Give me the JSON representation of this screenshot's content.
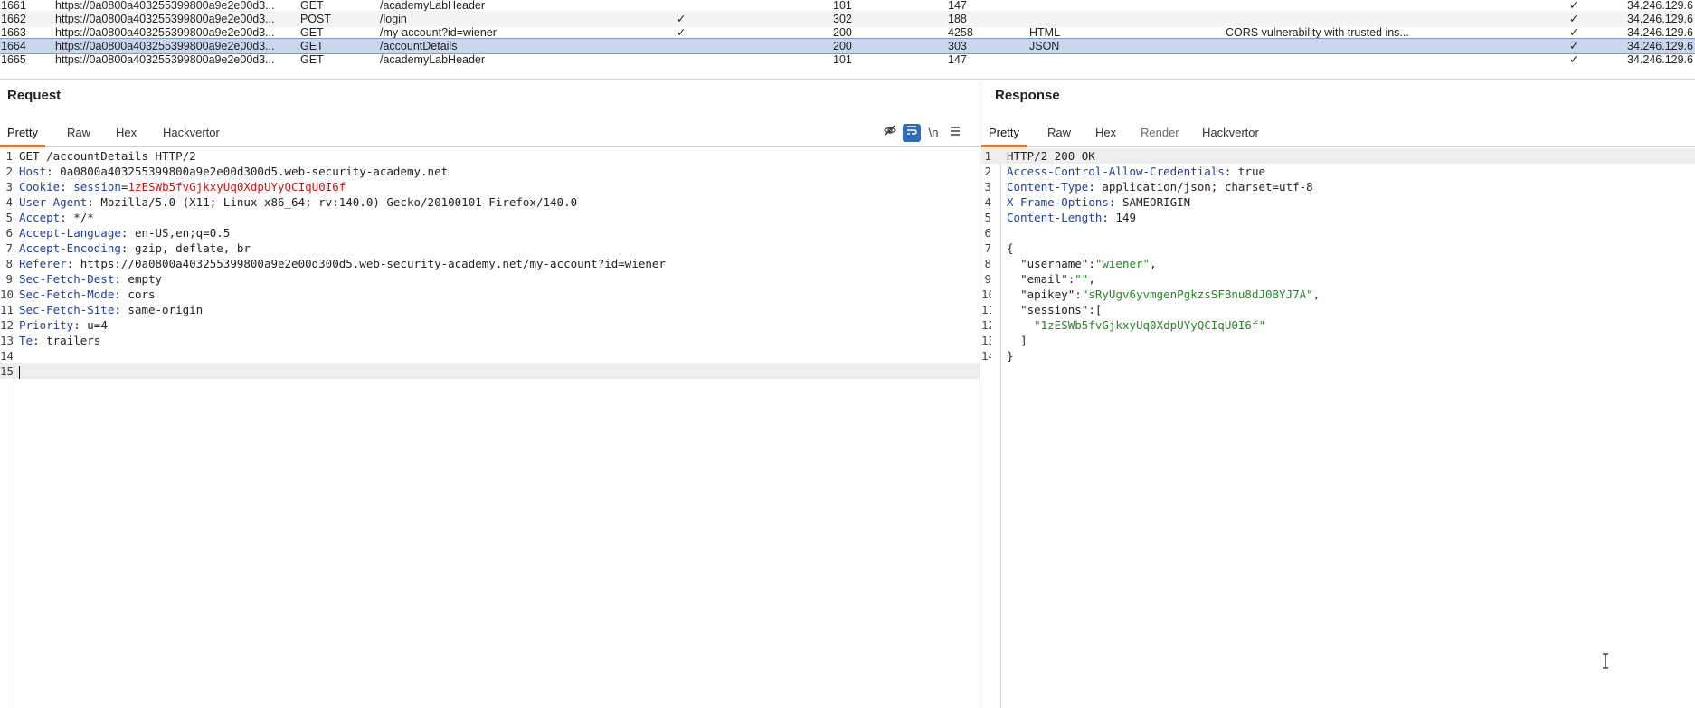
{
  "history": {
    "rows": [
      {
        "num": "1661",
        "host": "https://0a0800a403255399800a9e2e00d3...",
        "method": "GET",
        "url": "/academyLabHeader",
        "params": "",
        "status": "101",
        "length": "147",
        "mime": "",
        "title": "",
        "tls": "✓",
        "ip": "34.246.129.6"
      },
      {
        "num": "1662",
        "host": "https://0a0800a403255399800a9e2e00d3...",
        "method": "POST",
        "url": "/login",
        "params": "✓",
        "status": "302",
        "length": "188",
        "mime": "",
        "title": "",
        "tls": "✓",
        "ip": "34.246.129.6"
      },
      {
        "num": "1663",
        "host": "https://0a0800a403255399800a9e2e00d3...",
        "method": "GET",
        "url": "/my-account?id=wiener",
        "params": "✓",
        "status": "200",
        "length": "4258",
        "mime": "HTML",
        "title": "CORS vulnerability with trusted ins...",
        "tls": "✓",
        "ip": "34.246.129.6"
      },
      {
        "num": "1664",
        "host": "https://0a0800a403255399800a9e2e00d3...",
        "method": "GET",
        "url": "/accountDetails",
        "params": "",
        "status": "200",
        "length": "303",
        "mime": "JSON",
        "title": "",
        "tls": "✓",
        "ip": "34.246.129.6"
      },
      {
        "num": "1665",
        "host": "https://0a0800a403255399800a9e2e00d3...",
        "method": "GET",
        "url": "/academyLabHeader",
        "params": "",
        "status": "101",
        "length": "147",
        "mime": "",
        "title": "",
        "tls": "✓",
        "ip": "34.246.129.6"
      }
    ],
    "selected_index": 3
  },
  "request": {
    "title": "Request",
    "tabs": [
      "Pretty",
      "Raw",
      "Hex",
      "Hackvertor"
    ],
    "active_tab": "Pretty",
    "tools": {
      "hide_icon": "eye-slash-icon",
      "wrap_icon": "word-wrap-icon",
      "newline_label": "\\n",
      "menu_icon": "hamburger-menu-icon"
    },
    "lines": [
      {
        "n": "1",
        "text": "GET /accountDetails HTTP/2"
      },
      {
        "n": "2",
        "key": "Host",
        "value": "0a0800a403255399800a9e2e00d300d5.web-security-academy.net"
      },
      {
        "n": "3",
        "key": "Cookie",
        "cookie_name": "session",
        "cookie_value": "1zESWb5fvGjkxyUq0XdpUYyQCIqU0I6f"
      },
      {
        "n": "4",
        "key": "User-Agent",
        "value": "Mozilla/5.0 (X11; Linux x86_64; rv:140.0) Gecko/20100101 Firefox/140.0"
      },
      {
        "n": "5",
        "key": "Accept",
        "value": "*/*"
      },
      {
        "n": "6",
        "key": "Accept-Language",
        "value": "en-US,en;q=0.5"
      },
      {
        "n": "7",
        "key": "Accept-Encoding",
        "value": "gzip, deflate, br"
      },
      {
        "n": "8",
        "key": "Referer",
        "value": "https://0a0800a403255399800a9e2e00d300d5.web-security-academy.net/my-account?id=wiener"
      },
      {
        "n": "9",
        "key": "Sec-Fetch-Dest",
        "value": "empty"
      },
      {
        "n": "10",
        "key": "Sec-Fetch-Mode",
        "value": "cors"
      },
      {
        "n": "11",
        "key": "Sec-Fetch-Site",
        "value": "same-origin"
      },
      {
        "n": "12",
        "key": "Priority",
        "value": "u=4"
      },
      {
        "n": "13",
        "key": "Te",
        "value": "trailers"
      },
      {
        "n": "14",
        "text": ""
      },
      {
        "n": "15",
        "text": ""
      }
    ]
  },
  "response": {
    "title": "Response",
    "tabs": [
      "Pretty",
      "Raw",
      "Hex",
      "Render",
      "Hackvertor"
    ],
    "active_tab": "Pretty",
    "status_line": "HTTP/2 200 OK",
    "headers": [
      {
        "key": "Access-Control-Allow-Credentials",
        "value": "true"
      },
      {
        "key": "Content-Type",
        "value": "application/json; charset=utf-8"
      },
      {
        "key": "X-Frame-Options",
        "value": "SAMEORIGIN"
      },
      {
        "key": "Content-Length",
        "value": "149"
      }
    ],
    "json": {
      "open_brace": "{",
      "close_brace": "}",
      "username_key": "\"username\"",
      "username_val": "\"wiener\"",
      "email_key": "\"email\"",
      "email_val": "\"\"",
      "apikey_key": "\"apikey\"",
      "apikey_val": "\"sRyUgv6yvmgenPgkzsSFBnu8dJ0BYJ7A\"",
      "sessions_key": "\"sessions\"",
      "sessions_open": "[",
      "session_0": "\"1zESWb5fvGjkxyUq0XdpUYyQCIqU0I6f\"",
      "sessions_close": "]"
    }
  },
  "colors": {
    "accent_tab": "#e8742c",
    "selected_row": "#c8d7ec",
    "header_key": "#1f3f9a",
    "cookie_value": "#c01818",
    "json_string": "#1f8b1f"
  }
}
